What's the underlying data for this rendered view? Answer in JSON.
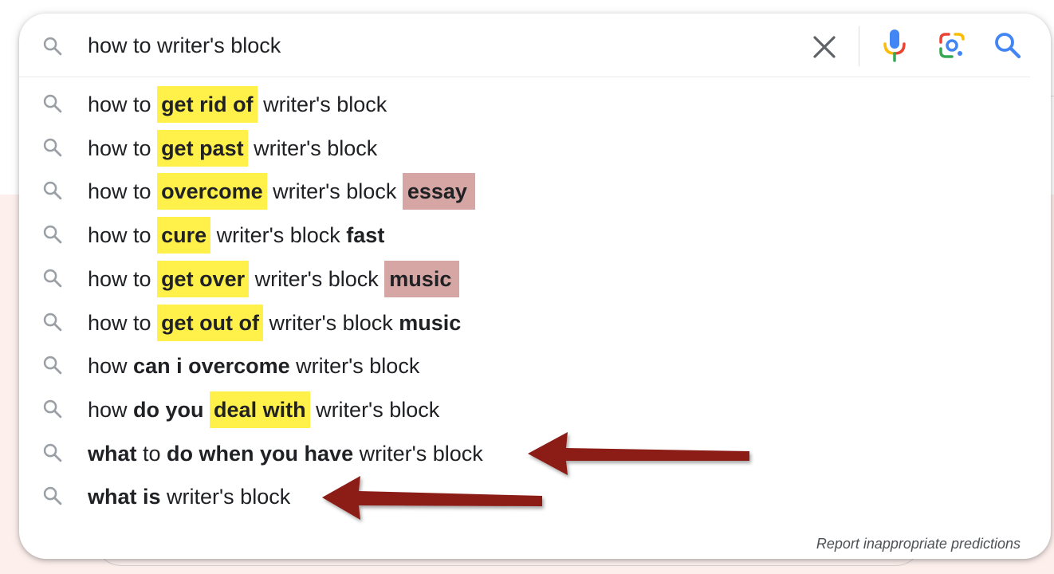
{
  "search": {
    "query": "how to writer's block",
    "clear_icon": "close-icon",
    "mic_icon": "microphone-icon",
    "lens_icon": "google-lens-icon",
    "submit_icon": "search-icon"
  },
  "suggestions": [
    {
      "segments": [
        {
          "text": "how to ",
          "bold": false,
          "highlight": null
        },
        {
          "text": "get rid of",
          "bold": true,
          "highlight": "yellow"
        },
        {
          "text": " writer's block",
          "bold": false,
          "highlight": null
        }
      ]
    },
    {
      "segments": [
        {
          "text": "how to ",
          "bold": false,
          "highlight": null
        },
        {
          "text": "get past",
          "bold": true,
          "highlight": "yellow"
        },
        {
          "text": " writer's block",
          "bold": false,
          "highlight": null
        }
      ]
    },
    {
      "segments": [
        {
          "text": "how to ",
          "bold": false,
          "highlight": null
        },
        {
          "text": "overcome",
          "bold": true,
          "highlight": "yellow"
        },
        {
          "text": " writer's block ",
          "bold": false,
          "highlight": null
        },
        {
          "text": "essay",
          "bold": true,
          "highlight": "red"
        }
      ]
    },
    {
      "segments": [
        {
          "text": "how to ",
          "bold": false,
          "highlight": null
        },
        {
          "text": "cure",
          "bold": true,
          "highlight": "yellow"
        },
        {
          "text": " writer's block ",
          "bold": false,
          "highlight": null
        },
        {
          "text": "fast",
          "bold": true,
          "highlight": null
        }
      ]
    },
    {
      "segments": [
        {
          "text": "how to ",
          "bold": false,
          "highlight": null
        },
        {
          "text": "get over",
          "bold": true,
          "highlight": "yellow"
        },
        {
          "text": " writer's block ",
          "bold": false,
          "highlight": null
        },
        {
          "text": "music",
          "bold": true,
          "highlight": "red"
        }
      ]
    },
    {
      "segments": [
        {
          "text": "how to ",
          "bold": false,
          "highlight": null
        },
        {
          "text": "get out of",
          "bold": true,
          "highlight": "yellow"
        },
        {
          "text": " writer's block ",
          "bold": false,
          "highlight": null
        },
        {
          "text": "music",
          "bold": true,
          "highlight": null
        }
      ]
    },
    {
      "segments": [
        {
          "text": "how ",
          "bold": false,
          "highlight": null
        },
        {
          "text": "can i overcome",
          "bold": true,
          "highlight": null
        },
        {
          "text": " writer's block",
          "bold": false,
          "highlight": null
        }
      ]
    },
    {
      "segments": [
        {
          "text": "how ",
          "bold": false,
          "highlight": null
        },
        {
          "text": "do you ",
          "bold": true,
          "highlight": null
        },
        {
          "text": "deal with",
          "bold": true,
          "highlight": "yellow"
        },
        {
          "text": " writer's block",
          "bold": false,
          "highlight": null
        }
      ]
    },
    {
      "segments": [
        {
          "text": "what",
          "bold": true,
          "highlight": null
        },
        {
          "text": " to ",
          "bold": false,
          "highlight": null
        },
        {
          "text": "do when you have",
          "bold": true,
          "highlight": null
        },
        {
          "text": " writer's block",
          "bold": false,
          "highlight": null
        }
      ]
    },
    {
      "segments": [
        {
          "text": "what is",
          "bold": true,
          "highlight": null
        },
        {
          "text": " writer's block",
          "bold": false,
          "highlight": null
        }
      ]
    }
  ],
  "report_link": "Report inappropriate predictions",
  "colors": {
    "highlight_yellow": "#fff04a",
    "highlight_red": "#d5a6a4",
    "arrow": "#8b1a17",
    "google_blue": "#4285f4",
    "google_red": "#ea4335",
    "google_yellow": "#fbbc04",
    "google_green": "#34a853"
  },
  "annotations": {
    "arrow_count": 2,
    "arrow_icon": "arrow-left-icon"
  }
}
